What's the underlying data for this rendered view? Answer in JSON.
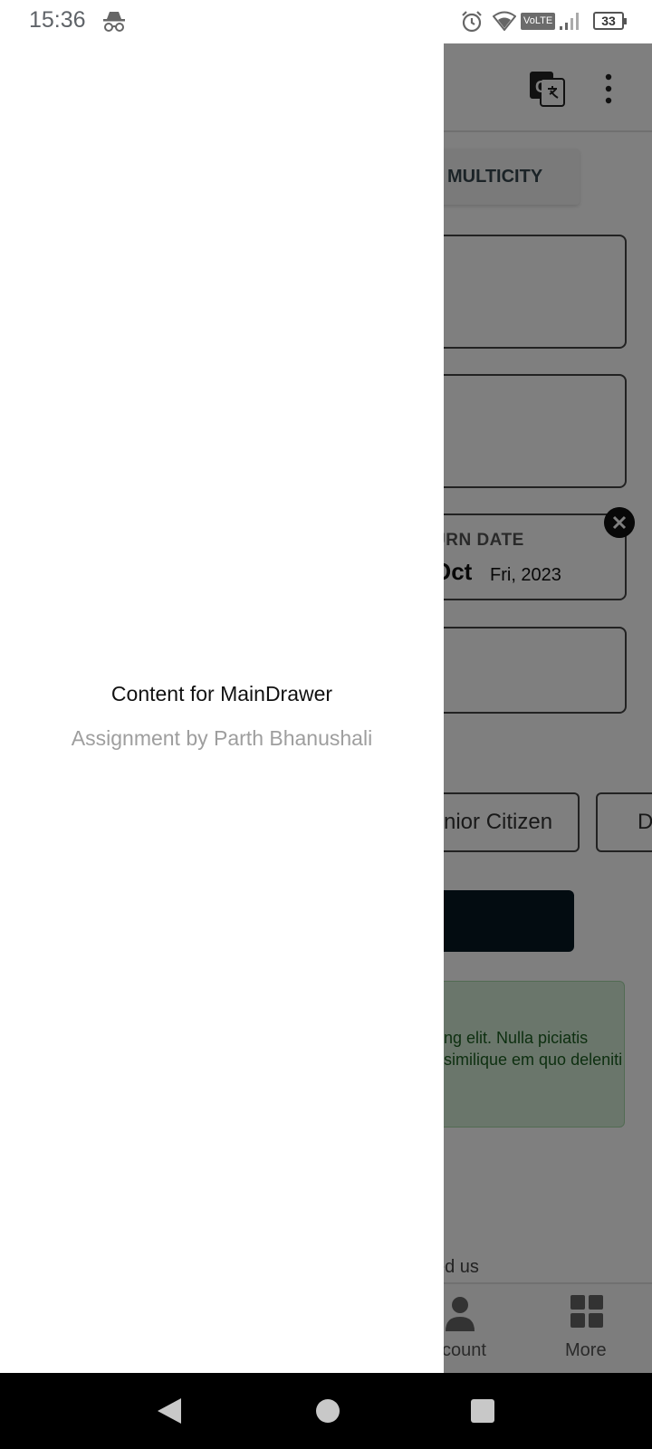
{
  "status_bar": {
    "time": "15:36",
    "network_badge": "VoLTE",
    "battery_level": "33",
    "icons": [
      "incognito-icon",
      "alarm-icon",
      "wifi-icon",
      "signal-icon",
      "battery-icon"
    ]
  },
  "app": {
    "toolbar_icons": [
      "translate-icon",
      "more-vert-icon"
    ],
    "trip_tab_label": "MULTICITY",
    "return_date": {
      "label": "URN DATE",
      "month": "Oct",
      "day_year": "Fri, 2023"
    },
    "chips": [
      "nior Citizen",
      "Dou"
    ],
    "info_text": "ng elit. Nulla piciatis similique em quo deleniti",
    "footer_text": "ed us",
    "bottom_nav": [
      {
        "label": "count",
        "icon": "person-icon"
      },
      {
        "label": "More",
        "icon": "grid-icon"
      }
    ]
  },
  "drawer": {
    "title": "Content for MainDrawer",
    "subtitle": "Assignment by Parth Bhanushali"
  },
  "colors": {
    "scrim": "#000000",
    "search_button": "#061822",
    "info_card": "#d4ecd6"
  }
}
